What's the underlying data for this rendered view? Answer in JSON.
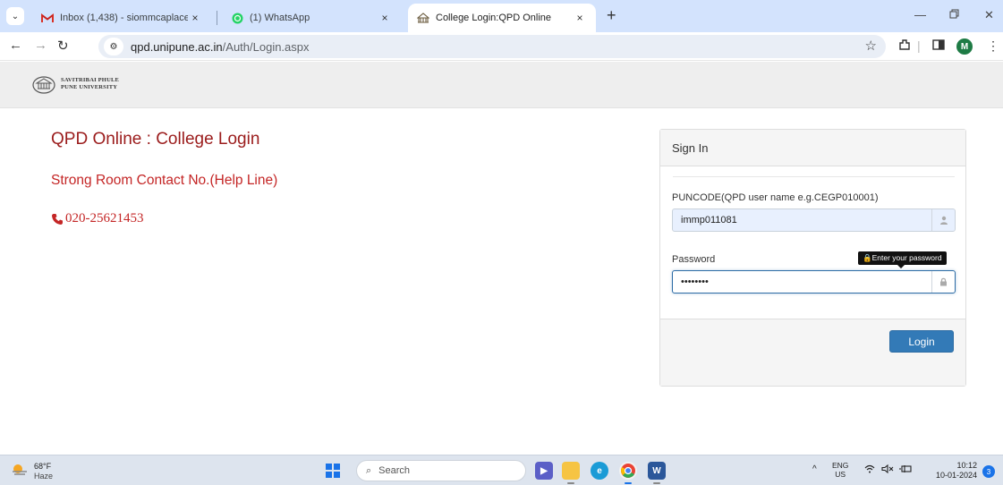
{
  "browser": {
    "tabs": [
      {
        "title": "Inbox (1,438) - siommcaplacem",
        "close": "×",
        "active": false
      },
      {
        "title": "(1) WhatsApp",
        "close": "×",
        "active": false
      },
      {
        "title": "College Login:QPD Online",
        "close": "×",
        "active": true
      }
    ],
    "new_tab": "+",
    "url_host": "qpd.unipune.ac.in",
    "url_path": "/Auth/Login.aspx",
    "profile_initial": "M"
  },
  "header": {
    "logo_line1": "SAVITRIBAI PHULE",
    "logo_line2": "PUNE UNIVERSITY"
  },
  "main": {
    "title": "QPD Online : College Login",
    "contact_heading": "Strong Room Contact No.(Help Line)",
    "phone": "020-25621453"
  },
  "signin": {
    "heading": "Sign In",
    "username_label": "PUNCODE(QPD user name e.g.CEGP010001)",
    "username_value": "immp011081",
    "password_label": "Password",
    "password_value": "••••••••",
    "password_tooltip": "Enter your password",
    "login_label": "Login"
  },
  "taskbar": {
    "weather_temp": "68°F",
    "weather_cond": "Haze",
    "search_placeholder": "Search",
    "lang_line1": "ENG",
    "lang_line2": "US",
    "time": "10:12",
    "date": "10-01-2024",
    "notification_count": "3"
  },
  "colors": {
    "title_red": "#9b1c1c",
    "contact_red": "#c42626",
    "login_blue": "#337ab7",
    "tabstrip": "#d3e3fd"
  }
}
